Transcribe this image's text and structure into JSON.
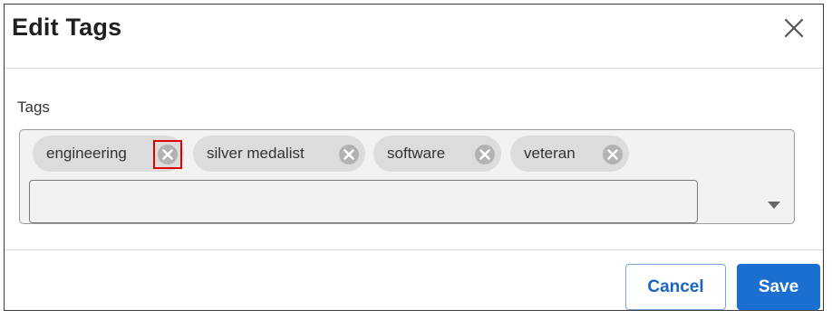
{
  "dialog": {
    "title": "Edit Tags",
    "close_icon": "close-icon"
  },
  "tags_field": {
    "label": "Tags",
    "chips": [
      {
        "label": "engineering",
        "remove_icon": "circle-x-icon",
        "highlighted": true
      },
      {
        "label": "silver medalist",
        "remove_icon": "circle-x-icon",
        "highlighted": false
      },
      {
        "label": "software",
        "remove_icon": "circle-x-icon",
        "highlighted": false
      },
      {
        "label": "veteran",
        "remove_icon": "circle-x-icon",
        "highlighted": false
      }
    ],
    "input_value": "",
    "dropdown_icon": "caret-down-icon"
  },
  "footer": {
    "cancel_label": "Cancel",
    "save_label": "Save"
  },
  "colors": {
    "primary": "#1a6fd0",
    "highlight": "#e00000",
    "chip_bg": "#dcdcdc",
    "field_bg": "#f2f2f2"
  }
}
